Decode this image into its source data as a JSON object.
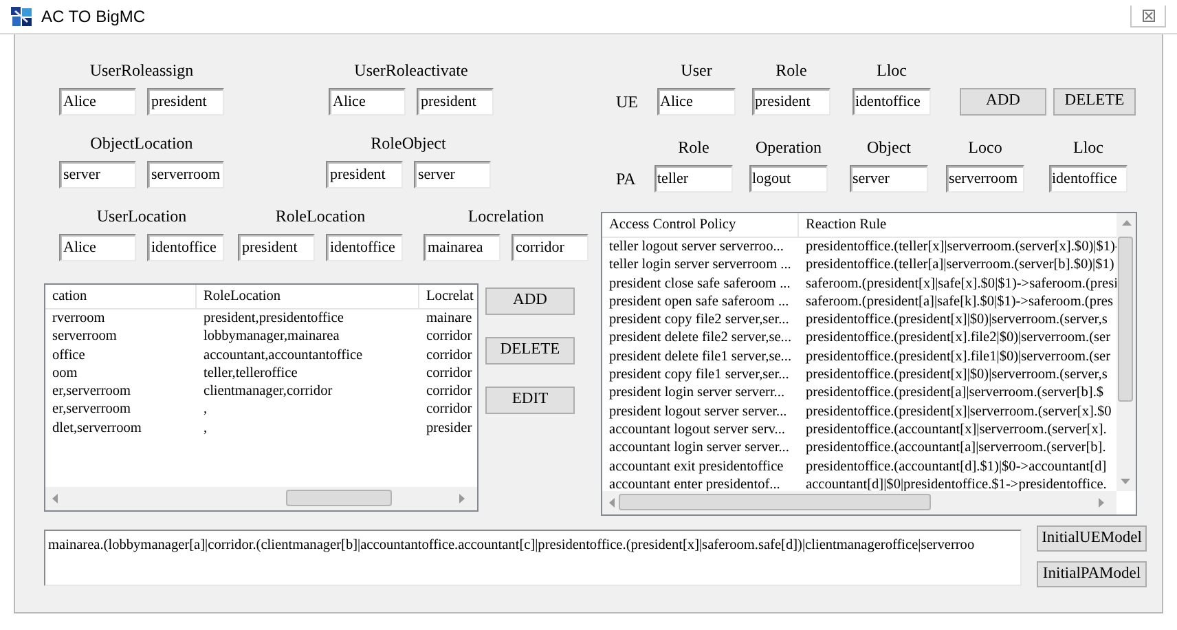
{
  "window": {
    "title": "AC TO BigMC"
  },
  "form_rows": [
    {
      "groups": [
        {
          "label": "UserRoleassign",
          "values": [
            "Alice",
            "president"
          ]
        },
        {
          "label": "UserRoleactivate",
          "values": [
            "Alice",
            "president"
          ]
        }
      ]
    },
    {
      "groups": [
        {
          "label": "ObjectLocation",
          "values": [
            "server",
            "serverroom"
          ]
        },
        {
          "label": "RoleObject",
          "values": [
            "president",
            "server"
          ]
        }
      ]
    },
    {
      "groups": [
        {
          "label": "UserLocation",
          "values": [
            "Alice",
            "identoffice"
          ]
        },
        {
          "label": "RoleLocation",
          "values": [
            "president",
            "identoffice"
          ]
        },
        {
          "label": "Locrelation",
          "values": [
            "mainarea",
            "corridor"
          ]
        }
      ]
    }
  ],
  "relations_table": {
    "columns": [
      "cation",
      "RoleLocation",
      "Locrelat"
    ],
    "rows": [
      [
        "rverroom",
        "president,presidentoffice",
        "mainare"
      ],
      [
        "serverroom",
        "lobbymanager,mainarea",
        "corridor"
      ],
      [
        "office",
        "accountant,accountantoffice",
        "corridor"
      ],
      [
        "oom",
        "teller,telleroffice",
        "corridor"
      ],
      [
        "er,serverroom",
        "clientmanager,corridor",
        "corridor"
      ],
      [
        "er,serverroom",
        ",",
        "corridor"
      ],
      [
        "dlet,serverroom",
        ",",
        "presider"
      ]
    ]
  },
  "relations_buttons": [
    "ADD",
    "DELETE",
    "EDIT"
  ],
  "ue": {
    "label": "UE",
    "fields": [
      {
        "label": "User",
        "value": "Alice"
      },
      {
        "label": "Role",
        "value": "president"
      },
      {
        "label": "Lloc",
        "value": "identoffice"
      }
    ],
    "buttons": [
      "ADD",
      "DELETE"
    ]
  },
  "pa": {
    "label": "PA",
    "fields": [
      {
        "label": "Role",
        "value": "teller"
      },
      {
        "label": "Operation",
        "value": "logout"
      },
      {
        "label": "Object",
        "value": "server"
      },
      {
        "label": "Loco",
        "value": "serverroom"
      },
      {
        "label": "Lloc",
        "value": "identoffice"
      }
    ]
  },
  "policy_table": {
    "columns": [
      "Access Control Policy",
      "Reaction Rule"
    ],
    "rows": [
      [
        "teller logout server serverroo...",
        "presidentoffice.(teller[x]|serverroom.(server[x].$0)|$1)-"
      ],
      [
        "teller login server serverroom ...",
        "presidentoffice.(teller[a]|serverroom.(server[b].$0)|$1)"
      ],
      [
        "president close safe saferoom ...",
        "saferoom.(president[x]|safe[x].$0|$1)->saferoom.(presi"
      ],
      [
        "president open safe saferoom ...",
        "saferoom.(president[a]|safe[k].$0|$1)->saferoom.(pres"
      ],
      [
        "president copy file2 server,ser...",
        "presidentoffice.(president[x]|$0)|serverroom.(server,s"
      ],
      [
        "president delete file2 server,se...",
        "presidentoffice.(president[x].file2|$0)|serverroom.(ser"
      ],
      [
        "president delete file1 server,se...",
        "presidentoffice.(president[x].file1|$0)|serverroom.(ser"
      ],
      [
        "president copy file1 server,ser...",
        "presidentoffice.(president[x]|$0)|serverroom.(server,s"
      ],
      [
        "president login server serverr...",
        "presidentoffice.(president[a]|serverroom.(server[b].$"
      ],
      [
        "president logout server server...",
        "presidentoffice.(president[x]|serverroom.(server[x].$0"
      ],
      [
        "accountant logout server serv...",
        "presidentoffice.(accountant[x]|serverroom.(server[x]."
      ],
      [
        "accountant login server server...",
        "presidentoffice.(accountant[a]|serverroom.(server[b]."
      ],
      [
        "accountant exit   presidentoffice",
        "presidentoffice.(accountant[d].$1)|$0->accountant[d]"
      ],
      [
        "accountant enter   presidentof...",
        "accountant[d]|$0|presidentoffice.$1->presidentoffice."
      ]
    ]
  },
  "model_text": "mainarea.(lobbymanager[a]|corridor.(clientmanager[b]|accountantoffice.accountant[c]|presidentoffice.(president[x]|saferoom.safe[d])|clientmanageroffice|serverroo",
  "model_buttons": [
    "InitialUEModel",
    "InitialPAModel"
  ]
}
